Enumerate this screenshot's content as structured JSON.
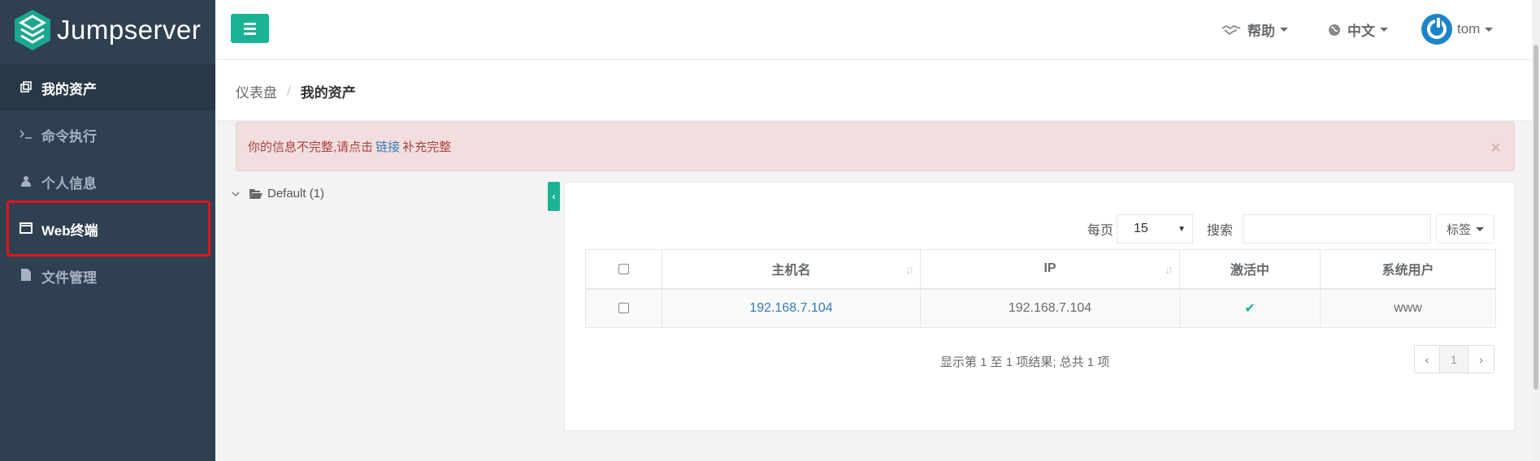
{
  "sidebar": {
    "logo_text": "Jumpserver",
    "items": [
      {
        "label": "我的资产",
        "icon": "assets-icon"
      },
      {
        "label": "命令执行",
        "icon": "terminal-icon"
      },
      {
        "label": "个人信息",
        "icon": "user-icon"
      },
      {
        "label": "Web终端",
        "icon": "window-icon"
      },
      {
        "label": "文件管理",
        "icon": "file-icon"
      }
    ]
  },
  "topbar": {
    "help_label": "帮助",
    "lang_label": "中文",
    "user_label": "tom"
  },
  "breadcrumb": {
    "home": "仪表盘",
    "separator": "/",
    "current": "我的资产"
  },
  "alert": {
    "text_before": "你的信息不完整,请点击",
    "link_text": "链接",
    "text_after": "补充完整",
    "close": "×"
  },
  "tree": {
    "node_label": "Default (1)"
  },
  "controls": {
    "per_page_label": "每页",
    "per_page_value": "15",
    "search_label": "搜索",
    "search_value": "",
    "tag_label": "标签"
  },
  "table": {
    "headers": [
      "主机名",
      "IP",
      "激活中",
      "系统用户"
    ],
    "rows": [
      {
        "hostname": "192.168.7.104",
        "ip": "192.168.7.104",
        "active": "✔",
        "system_user": "www"
      }
    ]
  },
  "pagination": {
    "info": "显示第 1 至 1 项结果; 总共 1 项",
    "prev": "‹",
    "current_page": "1",
    "next": "›"
  },
  "colors": {
    "sidebar_bg": "#2f4050",
    "accent": "#1ab394",
    "link": "#337ab7",
    "alert_bg": "#f2dede",
    "alert_text": "#a94442",
    "highlight_box": "#e3141a"
  }
}
